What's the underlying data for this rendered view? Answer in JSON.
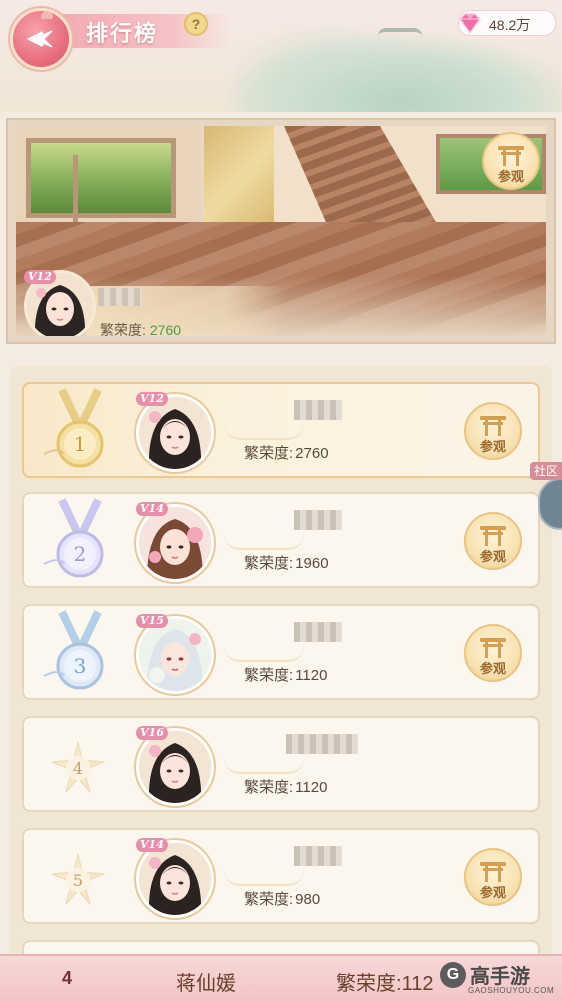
{
  "header": {
    "title": "排行榜",
    "help_icon_text": "?",
    "currency": {
      "icon": "pink-gem-icon",
      "value": "48.2万"
    }
  },
  "showcase": {
    "visit_label": "参观",
    "owner": {
      "vip": "V12",
      "score_label": "繁荣度:",
      "score_value": "2760"
    }
  },
  "rankings": [
    {
      "rank": "1",
      "vip": "V12",
      "score_label": "繁荣度:",
      "score": "2760",
      "visit": "参观",
      "medal": "gold"
    },
    {
      "rank": "2",
      "vip": "V14",
      "score_label": "繁荣度:",
      "score": "1960",
      "visit": "参观",
      "medal": "silver"
    },
    {
      "rank": "3",
      "vip": "V15",
      "score_label": "繁荣度:",
      "score": "1120",
      "visit": "参观",
      "medal": "bronze"
    },
    {
      "rank": "4",
      "vip": "V16",
      "score_label": "繁荣度:",
      "score": "1120",
      "visit": "",
      "medal": "none"
    },
    {
      "rank": "5",
      "vip": "V14",
      "score_label": "繁荣度:",
      "score": "980",
      "visit": "参观",
      "medal": "none"
    }
  ],
  "side_tab": {
    "label": "社区"
  },
  "my_rank": {
    "rank": "4",
    "name": "蒋仙媛",
    "score_label": "繁荣度:",
    "score": "112"
  },
  "watermark": {
    "text": "高手游",
    "url": "GAOSHOUYOU.COM"
  },
  "colors": {
    "accent_pink": "#e86f7f",
    "score_green": "#4d9b3f",
    "gold": "#e8c583"
  }
}
